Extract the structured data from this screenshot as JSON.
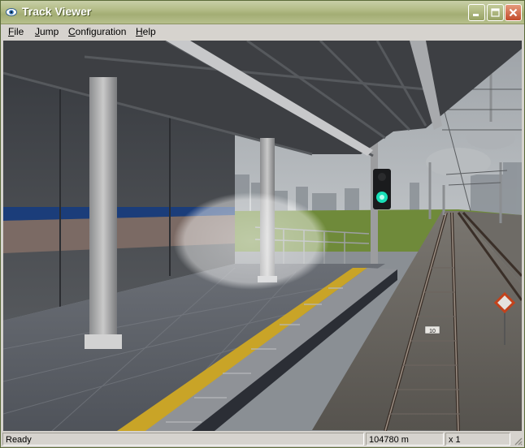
{
  "window": {
    "title": "Track Viewer"
  },
  "menu": {
    "file_label": "File",
    "jump_label": "Jump",
    "configuration_label": "Configuration",
    "help_label": "Help"
  },
  "scene": {
    "track_marker": "10"
  },
  "status": {
    "message": "Ready",
    "distance": "104780 m",
    "speed_multiplier": "x 1"
  },
  "colors": {
    "titlebar": "#a3ad74",
    "signal_green": "#19e0b8",
    "tactile_paving": "#c9a427"
  },
  "icons": {
    "app": "eye-icon",
    "minimize": "minimize-icon",
    "maximize": "maximize-icon",
    "close": "close-icon"
  }
}
